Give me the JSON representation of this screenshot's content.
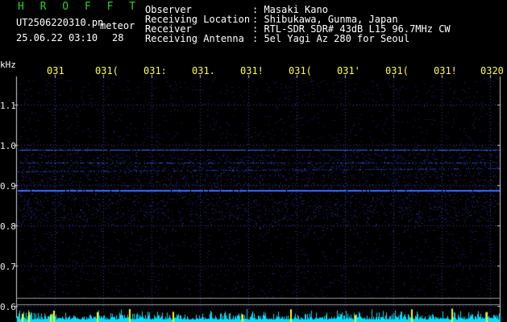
{
  "header": {
    "app_name": "H R O F F T",
    "filename": "UT2506220310.pn",
    "mode": "meteor",
    "date_time": "25.06.22 03:10",
    "count": "28",
    "info_labels": [
      "Observer",
      "Receiving Location",
      "Receiver",
      "Receiving Antenna"
    ],
    "info_values": [
      ": Masaki Kano",
      ": Shibukawa, Gunma, Japan",
      ": RTL-SDR SDR# 43dB L15 96.7MHz CW",
      ": 5el Yagi Az 280 for Seoul"
    ]
  },
  "axes": {
    "y_unit": "kHz",
    "y_ticks": [
      "1.1",
      "1.0",
      "0.9",
      "0.8",
      "0.7",
      "0.6"
    ],
    "x_ticks": [
      "031",
      "031(",
      "031:",
      "031.",
      "031!",
      "031(",
      "031'",
      "031(",
      "031!",
      "0320"
    ]
  },
  "colors": {
    "background": "#000000",
    "grid_dot": "#3a3aa0",
    "signal_line": "#3a6bff",
    "noise": "#12124a",
    "bottom_trace": "#00e0ff",
    "bottom_marker": "#ffff00"
  }
}
